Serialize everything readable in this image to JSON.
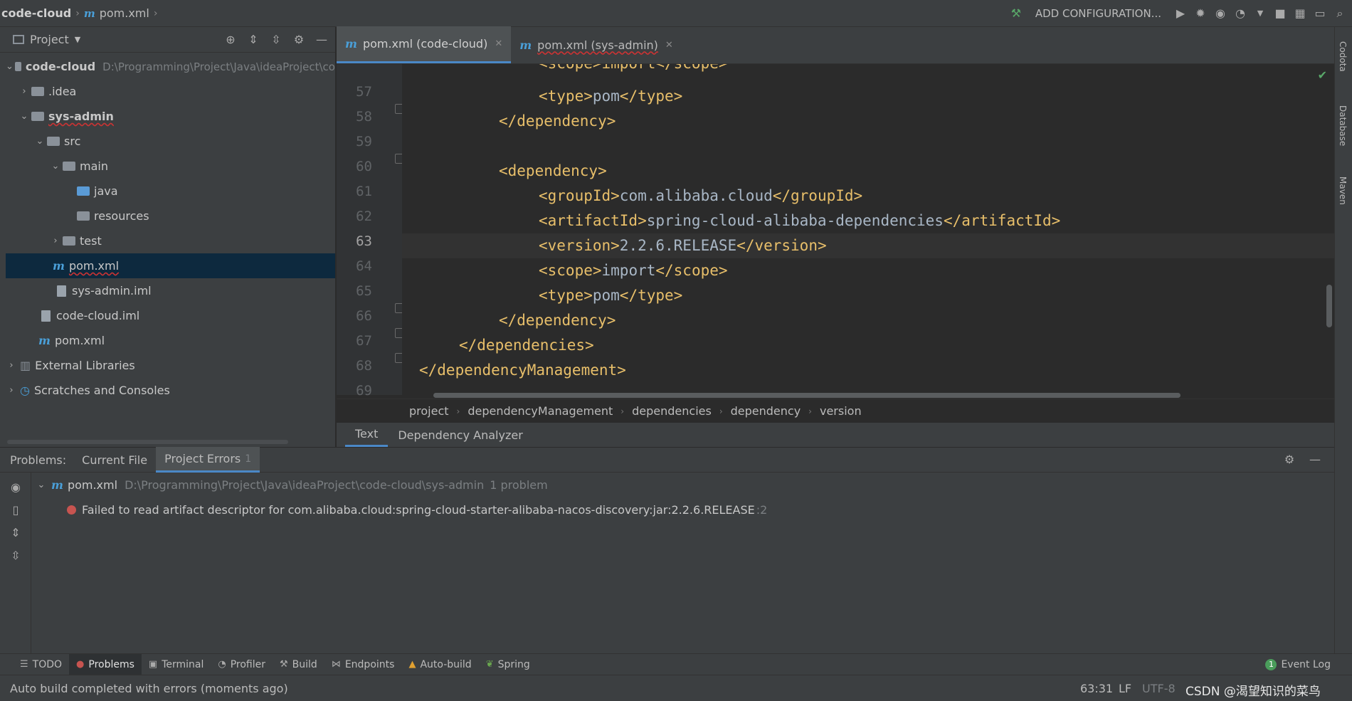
{
  "navbar": {
    "project": "code-cloud",
    "file": "pom.xml",
    "run_config": "ADD CONFIGURATION..."
  },
  "project_panel": {
    "title": "Project",
    "tree": [
      {
        "label": "code-cloud",
        "path": "D:\\Programming\\Project\\Java\\ideaProject\\co"
      },
      {
        "label": ".idea"
      },
      {
        "label": "sys-admin"
      },
      {
        "label": "src"
      },
      {
        "label": "main"
      },
      {
        "label": "java"
      },
      {
        "label": "resources"
      },
      {
        "label": "test"
      },
      {
        "label": "pom.xml"
      },
      {
        "label": "sys-admin.iml"
      },
      {
        "label": "code-cloud.iml"
      },
      {
        "label": "pom.xml"
      },
      {
        "label": "External Libraries"
      },
      {
        "label": "Scratches and Consoles"
      }
    ]
  },
  "editor": {
    "tabs": [
      {
        "label": "pom.xml (code-cloud)"
      },
      {
        "label": "pom.xml (sys-admin)"
      }
    ],
    "partial_top_line": "<scope>import</scope>",
    "lines": [
      {
        "num": "57",
        "open": "<type>",
        "text": "pom",
        "close": "</type>"
      },
      {
        "num": "58",
        "open": "",
        "text": "",
        "close": "</dependency>"
      },
      {
        "num": "59",
        "open": "",
        "text": "",
        "close": ""
      },
      {
        "num": "60",
        "open": "<dependency>",
        "text": "",
        "close": ""
      },
      {
        "num": "61",
        "open": "<groupId>",
        "text": "com.alibaba.cloud",
        "close": "</groupId>"
      },
      {
        "num": "62",
        "open": "<artifactId>",
        "text": "spring-cloud-alibaba-dependencies",
        "close": "</artifactId>"
      },
      {
        "num": "63",
        "open": "<version>",
        "text": "2.2.6.RELEASE",
        "close": "</version>"
      },
      {
        "num": "64",
        "open": "<scope>",
        "text": "import",
        "close": "</scope>"
      },
      {
        "num": "65",
        "open": "<type>",
        "text": "pom",
        "close": "</type>"
      },
      {
        "num": "66",
        "open": "",
        "text": "",
        "close": "</dependency>"
      },
      {
        "num": "67",
        "open": "",
        "text": "",
        "close": "</dependencies>"
      },
      {
        "num": "68",
        "open": "",
        "text": "",
        "close": "</dependencyManagement>"
      },
      {
        "num": "69",
        "open": "",
        "text": "",
        "close": ""
      }
    ],
    "breadcrumbs": [
      "project",
      "dependencyManagement",
      "dependencies",
      "dependency",
      "version"
    ],
    "subtabs": [
      "Text",
      "Dependency Analyzer"
    ]
  },
  "problems": {
    "label": "Problems:",
    "tabs": [
      {
        "label": "Current File"
      },
      {
        "label": "Project Errors",
        "count": "1"
      }
    ],
    "file": "pom.xml",
    "file_path": "D:\\Programming\\Project\\Java\\ideaProject\\code-cloud\\sys-admin",
    "file_count": "1 problem",
    "error": "Failed to read artifact descriptor for com.alibaba.cloud:spring-cloud-starter-alibaba-nacos-discovery:jar:2.2.6.RELEASE",
    "error_line": ":2"
  },
  "bottom_tools": [
    "TODO",
    "Problems",
    "Terminal",
    "Profiler",
    "Build",
    "Endpoints",
    "Auto-build",
    "Spring"
  ],
  "event_log": "Event Log",
  "event_count": "1",
  "status": {
    "message": "Auto build completed with errors (moments ago)",
    "position": "63:31",
    "line_sep": "LF",
    "encoding": "UTF-8",
    "watermark": "CSDN @渴望知识的菜鸟"
  },
  "right_strip": [
    "Codota",
    "Database",
    "Maven"
  ],
  "colors": {
    "tag": "#e8bf6a",
    "text": "#a9b7c6",
    "accent": "#4a88c7",
    "error": "#c75450"
  }
}
